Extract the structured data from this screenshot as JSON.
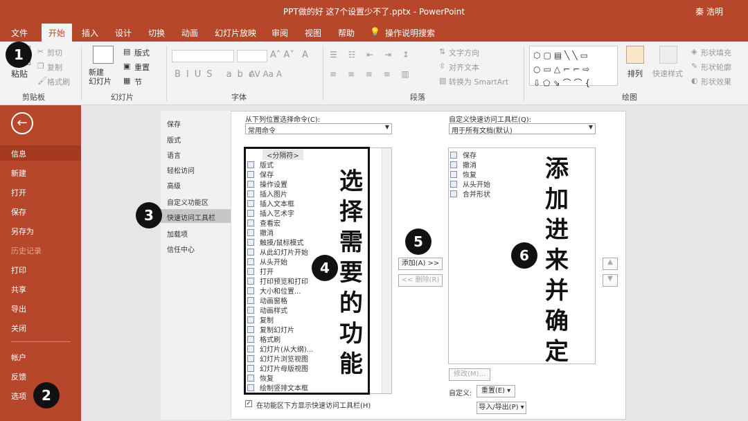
{
  "window": {
    "title": "PPT做的好 这7个设置少不了.pptx  -  PowerPoint",
    "user": "秦 浩明"
  },
  "tabs": [
    "文件",
    "开始",
    "插入",
    "设计",
    "切换",
    "动画",
    "幻灯片放映",
    "审阅",
    "视图",
    "帮助"
  ],
  "tell_me": "操作说明搜索",
  "ribbon": {
    "clipboard": {
      "paste": "粘贴",
      "cut": "剪切",
      "copy": "复制",
      "format_painter": "格式刷",
      "group": "剪贴板"
    },
    "slides": {
      "new_slide": "新建\n幻灯片",
      "layout": "版式",
      "reset": "重置",
      "section": "节",
      "group": "幻灯片"
    },
    "font": {
      "group": "字体"
    },
    "paragraph": {
      "text_direction": "文字方向",
      "align_text": "对齐文本",
      "smartart": "转换为 SmartArt",
      "group": "段落"
    },
    "drawing": {
      "arrange": "排列",
      "quick_styles": "快速样式",
      "shape_fill": "形状填充",
      "shape_outline": "形状轮廓",
      "shape_effects": "形状效果",
      "group": "绘图"
    }
  },
  "backstage": {
    "items": [
      "信息",
      "新建",
      "打开",
      "保存",
      "另存为",
      "历史记录",
      "打印",
      "共享",
      "导出",
      "关闭",
      "帐户",
      "反馈",
      "选项"
    ],
    "selected": "信息"
  },
  "options_nav": {
    "items": [
      "保存",
      "版式",
      "语言",
      "轻松访问",
      "高级",
      "自定义功能区",
      "快速访问工具栏",
      "加载项",
      "信任中心"
    ],
    "selected": "快速访问工具栏"
  },
  "choose_from": {
    "label": "从下列位置选择命令(C):",
    "value": "常用命令"
  },
  "customize_for": {
    "label": "自定义快速访问工具栏(Q):",
    "value": "用于所有文档(默认)"
  },
  "commands": [
    "<分隔符>",
    "版式",
    "保存",
    "操作设置",
    "插入图片",
    "插入文本框",
    "插入艺术字",
    "查看宏",
    "撤消",
    "触摸/鼠标模式",
    "从此幻灯片开始",
    "从头开始",
    "打开",
    "打印预览和打印",
    "大小和位置...",
    "动画窗格",
    "动画样式",
    "复制",
    "复制幻灯片",
    "格式刷",
    "幻灯片(从大纲)...",
    "幻灯片浏览视图",
    "幻灯片母版视图",
    "恢复",
    "绘制竖排文本框"
  ],
  "qat_items": [
    "保存",
    "撤消",
    "恢复",
    "从头开始",
    "合并形状"
  ],
  "buttons": {
    "add": "添加(A) >>",
    "remove": "<< 删除(R)",
    "modify": "修改(M)...",
    "customize_label": "自定义:",
    "reset": "重置(E) ▾",
    "import_export": "导入/导出(P) ▾"
  },
  "checkbox_label": "在功能区下方显示快速访问工具栏(H)",
  "annotations": {
    "badges": [
      "1",
      "2",
      "3",
      "4",
      "5",
      "6"
    ],
    "select_text": "选择需要的功能",
    "add_text": "添加进来并确定"
  }
}
